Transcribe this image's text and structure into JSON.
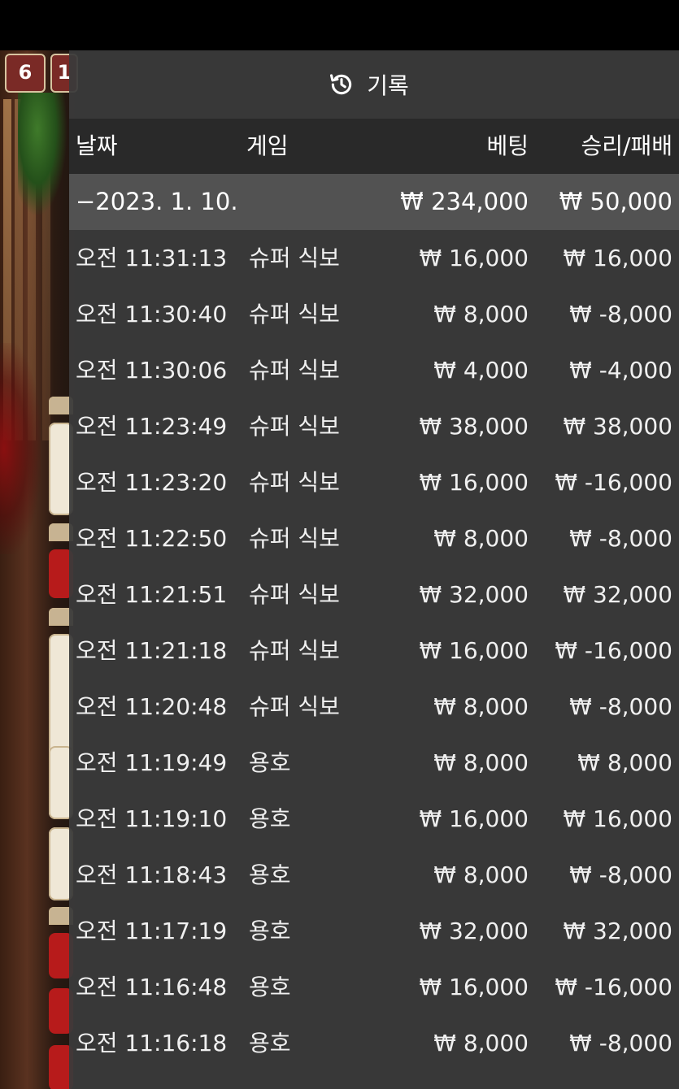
{
  "background": {
    "badges": [
      "6",
      "1"
    ],
    "accent_red": "#b71b1b",
    "tile_color": "#efe7d6"
  },
  "panel": {
    "title": "기록",
    "title_icon": "history-icon",
    "columns": {
      "date": "날짜",
      "game": "게임",
      "bet": "베팅",
      "result": "승리/패배"
    },
    "date_group": {
      "label": "−2023. 1. 10.",
      "total_bet": "₩ 234,000",
      "total_result": "₩ 50,000"
    },
    "rows": [
      {
        "time": "오전 11:31:13",
        "game": "슈퍼 식보",
        "bet": "₩ 16,000",
        "result": "₩ 16,000"
      },
      {
        "time": "오전 11:30:40",
        "game": "슈퍼 식보",
        "bet": "₩ 8,000",
        "result": "₩ -8,000"
      },
      {
        "time": "오전 11:30:06",
        "game": "슈퍼 식보",
        "bet": "₩ 4,000",
        "result": "₩ -4,000"
      },
      {
        "time": "오전 11:23:49",
        "game": "슈퍼 식보",
        "bet": "₩ 38,000",
        "result": "₩ 38,000"
      },
      {
        "time": "오전 11:23:20",
        "game": "슈퍼 식보",
        "bet": "₩ 16,000",
        "result": "₩ -16,000"
      },
      {
        "time": "오전 11:22:50",
        "game": "슈퍼 식보",
        "bet": "₩ 8,000",
        "result": "₩ -8,000"
      },
      {
        "time": "오전 11:21:51",
        "game": "슈퍼 식보",
        "bet": "₩ 32,000",
        "result": "₩ 32,000"
      },
      {
        "time": "오전 11:21:18",
        "game": "슈퍼 식보",
        "bet": "₩ 16,000",
        "result": "₩ -16,000"
      },
      {
        "time": "오전 11:20:48",
        "game": "슈퍼 식보",
        "bet": "₩ 8,000",
        "result": "₩ -8,000"
      },
      {
        "time": "오전 11:19:49",
        "game": "용호",
        "bet": "₩ 8,000",
        "result": "₩ 8,000"
      },
      {
        "time": "오전 11:19:10",
        "game": "용호",
        "bet": "₩ 16,000",
        "result": "₩ 16,000"
      },
      {
        "time": "오전 11:18:43",
        "game": "용호",
        "bet": "₩ 8,000",
        "result": "₩ -8,000"
      },
      {
        "time": "오전 11:17:19",
        "game": "용호",
        "bet": "₩ 32,000",
        "result": "₩ 32,000"
      },
      {
        "time": "오전 11:16:48",
        "game": "용호",
        "bet": "₩ 16,000",
        "result": "₩ -16,000"
      },
      {
        "time": "오전 11:16:18",
        "game": "용호",
        "bet": "₩ 8,000",
        "result": "₩ -8,000"
      }
    ]
  }
}
